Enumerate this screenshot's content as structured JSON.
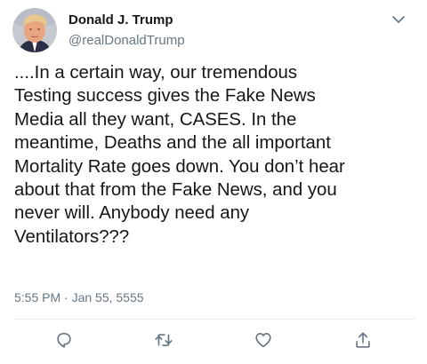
{
  "tweet": {
    "author": {
      "display_name": "Donald J. Trump",
      "handle": "@realDonaldTrump"
    },
    "text": "....In a certain way, our tremendous\nTesting success gives the Fake News\nMedia all they want, CASES. In the\nmeantime, Deaths and the all important\nMortality Rate goes down. You don’t hear\nabout that from the Fake News, and you\nnever will. Anybody need any\nVentilators???",
    "timestamp": "5:55 PM · Jan 55, 5555"
  },
  "icons": {
    "menu": "chevron-down-icon",
    "reply": "reply-icon",
    "retweet": "retweet-icon",
    "like": "heart-icon",
    "share": "share-icon"
  },
  "colors": {
    "text_primary": "#14171a",
    "text_secondary": "#657786",
    "icon": "#657786",
    "divider": "#e6ecf0"
  }
}
